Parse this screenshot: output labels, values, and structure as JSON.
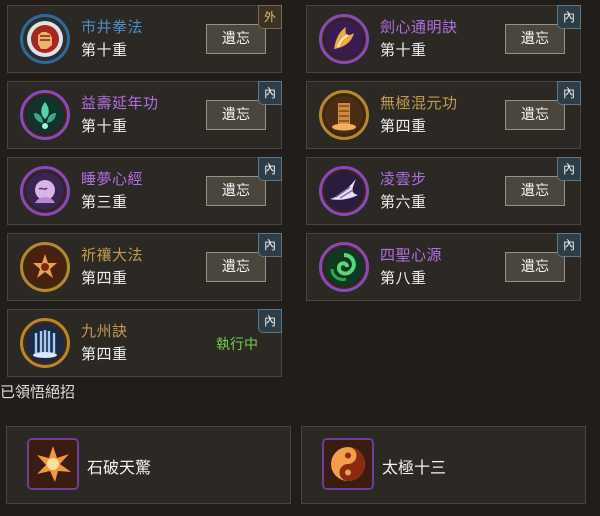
{
  "colors": {
    "type_external": "#4a8ec8",
    "type_internal": "#b06ee0",
    "type_neutral": "#c09a50",
    "active_green": "#72d050",
    "tag_external_text": "#e0c070"
  },
  "forget_label": "遺忘",
  "skills": [
    {
      "name": "市井拳法",
      "level": "第十重",
      "tag": "外",
      "icon": "fist-icon",
      "action": "button"
    },
    {
      "name": "劍心通明訣",
      "level": "第十重",
      "tag": "內",
      "icon": "claw-flame-icon",
      "action": "button"
    },
    {
      "name": "益壽延年功",
      "level": "第十重",
      "tag": "內",
      "icon": "lotus-icon",
      "action": "button"
    },
    {
      "name": "無極混元功",
      "level": "第四重",
      "tag": "內",
      "icon": "pillar-icon",
      "action": "button"
    },
    {
      "name": "睡夢心經",
      "level": "第三重",
      "tag": "內",
      "icon": "dream-icon",
      "action": "button"
    },
    {
      "name": "凌雲步",
      "level": "第六重",
      "tag": "內",
      "icon": "wing-icon",
      "action": "button"
    },
    {
      "name": "祈禳大法",
      "level": "第四重",
      "tag": "內",
      "icon": "seal-icon",
      "action": "button"
    },
    {
      "name": "四聖心源",
      "level": "第八重",
      "tag": "內",
      "icon": "vortex-icon",
      "action": "button"
    },
    {
      "name": "九州訣",
      "level": "第四重",
      "tag": "內",
      "icon": "columns-icon",
      "action": "status",
      "status": "執行中"
    }
  ],
  "section_title": "已領悟絕招",
  "combos": [
    {
      "name": "石破天驚",
      "icon": "rock-burst-icon"
    },
    {
      "name": "太極十三",
      "icon": "taiji-icon"
    }
  ]
}
